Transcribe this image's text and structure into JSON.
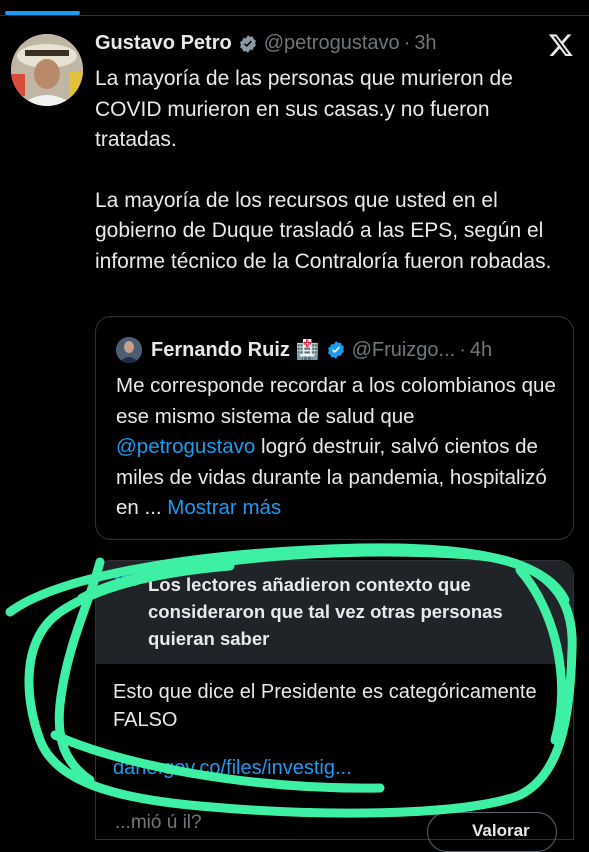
{
  "tweet": {
    "author_name": "Gustavo Petro",
    "handle": "@petrogustavo",
    "separator": "·",
    "time": "3h",
    "paragraph_1": "La mayoría de las personas que murieron de COVID murieron en sus casas.y no fueron tratadas.",
    "paragraph_2": "La mayoría de los recursos que usted en el gobierno de Duque trasladó a las EPS, según el informe técnico de la Contraloría fueron robadas."
  },
  "quoted_tweet": {
    "author_name": "Fernando Ruiz",
    "emoji": "🏥",
    "handle": "@Fruizgo...",
    "separator": "·",
    "time": "4h",
    "text_before": "Me corresponde recordar a los colombianos que ese mismo sistema de salud que ",
    "mention": "@petrogustavo",
    "text_after": " logró destruir, salvó cientos de miles de vidas durante la pandemia, hospitalizó en ... ",
    "show_more": "Mostrar más"
  },
  "community_note": {
    "title": "Los lectores añadieron contexto que consideraron que tal vez otras personas quieran saber",
    "body": "Esto que dice el Presidente es categóricamente FALSO",
    "link": "dane.gov.co/files/investig..."
  },
  "bottom": {
    "faded_text": "...mió  ú  il?",
    "button_label": "Valorar"
  },
  "colors": {
    "accent": "#1d9bf0",
    "highlight": "#3ef0a4",
    "background": "#000000"
  },
  "icons": [
    "verified-badge-icon",
    "x-logo-icon",
    "people-icon"
  ]
}
